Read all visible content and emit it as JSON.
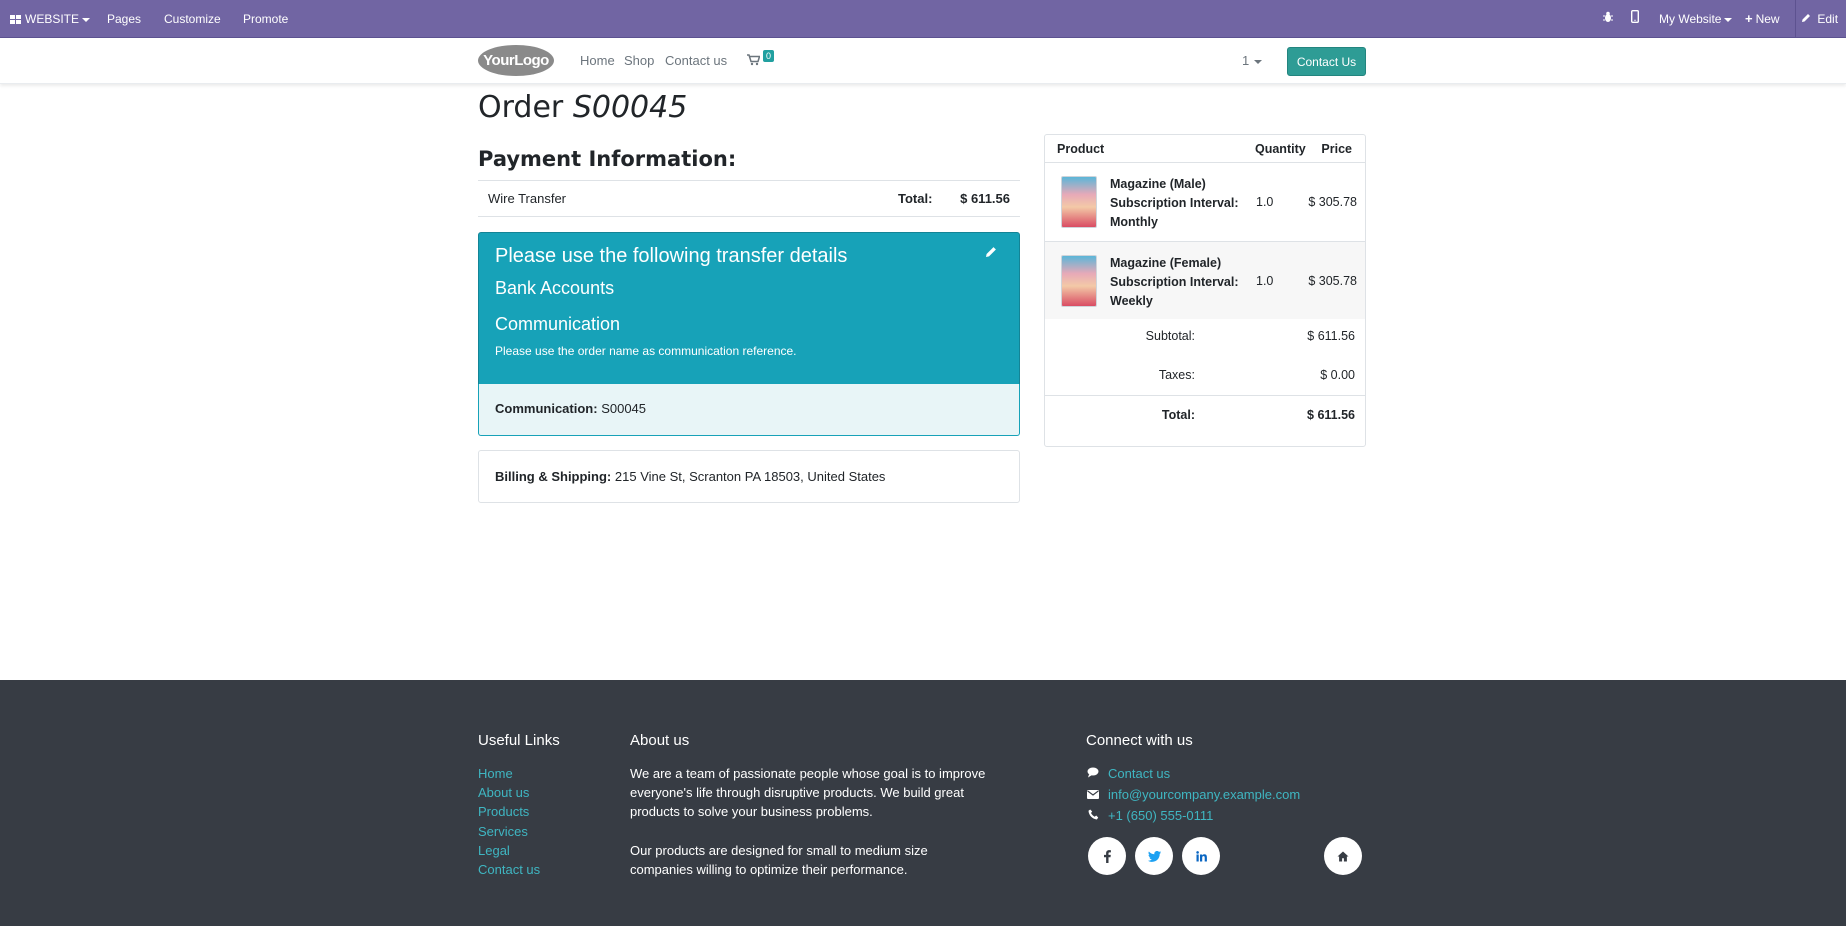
{
  "adminbar": {
    "website": "WEBSITE",
    "pages": "Pages",
    "customize": "Customize",
    "promote": "Promote",
    "my_website": "My Website",
    "new": "New",
    "edit": "Edit"
  },
  "navbar": {
    "logo": "YourLogo",
    "home": "Home",
    "shop": "Shop",
    "contact": "Contact us",
    "cart_count": "0",
    "pricelist": "1",
    "contact_button": "Contact Us"
  },
  "order": {
    "title_prefix": "Order",
    "number": "S00045"
  },
  "payment": {
    "heading": "Payment Information:",
    "method": "Wire Transfer",
    "total_label": "Total:",
    "total_value": "$ 611.56"
  },
  "transfer": {
    "heading": "Please use the following transfer details",
    "bank": "Bank Accounts",
    "communication_heading": "Communication",
    "note": "Please use the order name as communication reference.",
    "communication_label": "Communication:",
    "communication_value": "S00045"
  },
  "billing": {
    "label": "Billing & Shipping:",
    "address": "215 Vine St, Scranton PA 18503, United States"
  },
  "summary": {
    "headers": {
      "product": "Product",
      "quantity": "Quantity",
      "price": "Price"
    },
    "items": [
      {
        "name": "Magazine (Male) Subscription Interval: Monthly",
        "quantity": "1.0",
        "price": "$ 305.78"
      },
      {
        "name": "Magazine (Female) Subscription Interval: Weekly",
        "quantity": "1.0",
        "price": "$ 305.78"
      }
    ],
    "subtotal_label": "Subtotal:",
    "subtotal_value": "$ 611.56",
    "taxes_label": "Taxes:",
    "taxes_value": "$ 0.00",
    "total_label": "Total:",
    "total_value": "$ 611.56"
  },
  "footer": {
    "useful_links_title": "Useful Links",
    "links": [
      "Home",
      "About us",
      "Products",
      "Services",
      "Legal",
      "Contact us"
    ],
    "about_title": "About us",
    "about_p1": "We are a team of passionate people whose goal is to improve everyone's life through disruptive products. We build great products to solve your business problems.",
    "about_p2": "Our products are designed for small to medium size companies willing to optimize their performance.",
    "connect_title": "Connect with us",
    "contact_link": "Contact us",
    "email": "info@yourcompany.example.com",
    "phone": "+1 (650) 555-0111"
  },
  "colors": {
    "adminbar": "#7165a3",
    "accent": "#2e9c95",
    "transfer_bg": "#17a2b8",
    "footer_bg": "#373c44",
    "link": "#3fb6c2"
  }
}
